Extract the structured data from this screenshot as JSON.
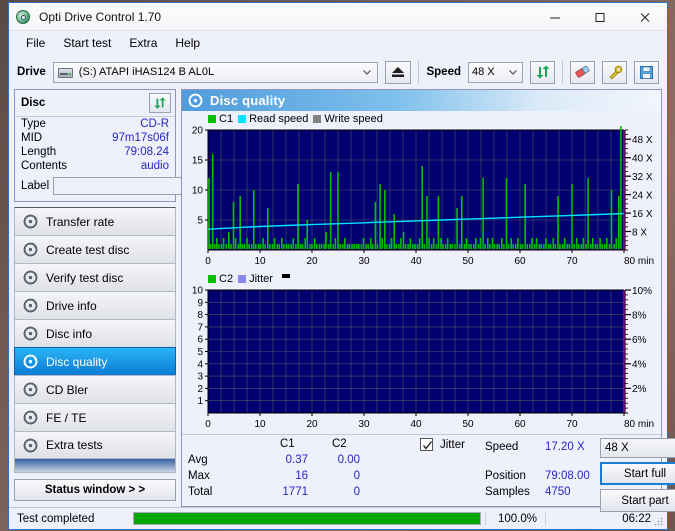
{
  "window": {
    "title": "Opti Drive Control 1.70",
    "app_icon": "disc-icon",
    "minimize": "—",
    "maximize": "□",
    "close": "✕"
  },
  "menu": {
    "items": [
      "File",
      "Start test",
      "Extra",
      "Help"
    ]
  },
  "toolbar": {
    "drive_label": "Drive",
    "drive_value": "(S:)  ATAPI iHAS124   B AL0L",
    "eject_icon": "eject-icon",
    "speed_label": "Speed",
    "speed_value": "48 X",
    "refresh_icon": "refresh-icon",
    "eraser_icon": "eraser-icon",
    "tools_icon": "tools-icon",
    "save_icon": "save-icon"
  },
  "disc_panel": {
    "title": "Disc",
    "refresh_icon": "refresh-icon",
    "rows": [
      {
        "key": "Type",
        "value": "CD-R"
      },
      {
        "key": "MID",
        "value": "97m17s06f"
      },
      {
        "key": "Length",
        "value": "79:08.24"
      },
      {
        "key": "Contents",
        "value": "audio"
      }
    ],
    "label_key": "Label",
    "label_value": "",
    "label_placeholder": "",
    "disc_icon": "cd-disc-icon"
  },
  "tabs": [
    {
      "label": "Transfer rate",
      "icon": "disc-icon",
      "active": false
    },
    {
      "label": "Create test disc",
      "icon": "disc-icon",
      "active": false
    },
    {
      "label": "Verify test disc",
      "icon": "disc-icon",
      "active": false
    },
    {
      "label": "Drive info",
      "icon": "disc-icon",
      "active": false
    },
    {
      "label": "Disc info",
      "icon": "disc-icon",
      "active": false
    },
    {
      "label": "Disc quality",
      "icon": "disc-icon",
      "active": true
    },
    {
      "label": "CD Bler",
      "icon": "disc-icon",
      "active": false
    },
    {
      "label": "FE / TE",
      "icon": "disc-icon",
      "active": false
    },
    {
      "label": "Extra tests",
      "icon": "disc-icon",
      "active": false
    }
  ],
  "status_window_button": "Status window > >",
  "panel": {
    "header_title": "Disc quality",
    "header_icon": "disc-quality-icon"
  },
  "stats": {
    "col_c1": "C1",
    "col_c2": "C2",
    "rows": [
      {
        "label": "Avg",
        "c1": "0.37",
        "c2": "0.00"
      },
      {
        "label": "Max",
        "c1": "16",
        "c2": "0"
      },
      {
        "label": "Total",
        "c1": "1771",
        "c2": "0"
      }
    ],
    "jitter_label": "Jitter",
    "jitter_checked": true,
    "speed_label": "Speed",
    "speed_value": "17.20 X",
    "position_label": "Position",
    "position_value": "79:08.00",
    "samples_label": "Samples",
    "samples_value": "4750",
    "speed_select": "48 X",
    "start_full": "Start full",
    "start_part": "Start part"
  },
  "statusbar": {
    "text": "Test completed",
    "progress_percent": 100.0,
    "percent_label": "100.0%",
    "elapsed": "06:22"
  },
  "colors": {
    "c1": "#00c000",
    "c2": "#00c000",
    "read_speed": "#00e5ff",
    "write_speed": "#808080",
    "jitter": "#8888ee",
    "plot_bg": "#000070",
    "grid": "#707060",
    "accent": "#2626c8",
    "progress": "#00a800",
    "title_blue": "#2a6fc9",
    "marker_magenta": "#e000e0"
  },
  "chart_data": [
    {
      "id": "c1-chart",
      "type": "bar",
      "title": "C1 / Read speed",
      "xlabel": "min",
      "ylabel": "",
      "xlim": [
        0,
        80
      ],
      "xticks": [
        0,
        10,
        20,
        30,
        40,
        50,
        60,
        70,
        80
      ],
      "xtick_labels": [
        "0",
        "10",
        "20",
        "30",
        "40",
        "50",
        "60",
        "70",
        "80 min"
      ],
      "ylim": [
        0,
        20
      ],
      "yticks": [
        5,
        10,
        15,
        20
      ],
      "ytick_labels": [
        "5",
        "10",
        "15",
        "20"
      ],
      "y2lim": [
        0,
        52
      ],
      "y2ticks": [
        8,
        16,
        24,
        32,
        40,
        48
      ],
      "y2tick_labels": [
        "8 X",
        "16 X",
        "24 X",
        "32 X",
        "40 X",
        "48 X"
      ],
      "grid": true,
      "legend": [
        {
          "name": "C1",
          "color": "#00c000"
        },
        {
          "name": "Read speed",
          "color": "#00e5ff"
        },
        {
          "name": "Write speed",
          "color": "#808080"
        }
      ],
      "series": [
        {
          "name": "C1",
          "kind": "impulse",
          "color": "#00c000",
          "x": [
            0.2,
            0.5,
            0.9,
            1.3,
            1.7,
            2.1,
            2.6,
            3.0,
            3.5,
            4.0,
            4.4,
            4.9,
            5.3,
            5.8,
            6.2,
            6.6,
            7.0,
            7.5,
            7.9,
            8.4,
            8.8,
            9.2,
            9.7,
            10.1,
            10.6,
            11.0,
            11.5,
            11.9,
            12.4,
            12.8,
            13.3,
            13.7,
            14.2,
            14.6,
            15.1,
            15.5,
            16.0,
            16.4,
            16.9,
            17.3,
            17.8,
            18.2,
            18.7,
            19.1,
            19.6,
            20.0,
            20.5,
            20.9,
            21.4,
            21.8,
            22.3,
            22.7,
            23.2,
            23.6,
            24.1,
            24.5,
            25.0,
            25.4,
            25.9,
            26.3,
            26.8,
            27.2,
            27.7,
            28.1,
            28.6,
            29.0,
            29.5,
            29.9,
            30.4,
            30.8,
            31.3,
            31.7,
            32.2,
            32.6,
            33.1,
            33.5,
            34.0,
            34.4,
            34.9,
            35.3,
            35.8,
            36.2,
            36.7,
            37.1,
            37.6,
            38.0,
            38.5,
            38.9,
            39.4,
            39.8,
            40.3,
            40.7,
            41.2,
            41.6,
            42.1,
            42.5,
            43.0,
            43.4,
            43.9,
            44.3,
            44.8,
            45.2,
            45.7,
            46.1,
            46.6,
            47.0,
            47.5,
            47.9,
            48.4,
            48.8,
            49.3,
            49.7,
            50.2,
            50.6,
            51.1,
            51.5,
            52.0,
            52.4,
            52.9,
            53.3,
            53.8,
            54.2,
            54.7,
            55.1,
            55.6,
            56.0,
            56.5,
            56.9,
            57.4,
            57.8,
            58.3,
            58.7,
            59.2,
            59.6,
            60.1,
            60.5,
            61.0,
            61.4,
            61.9,
            62.3,
            62.8,
            63.2,
            63.7,
            64.1,
            64.6,
            65.0,
            65.5,
            65.9,
            66.4,
            66.8,
            67.3,
            67.7,
            68.2,
            68.6,
            69.1,
            69.5,
            70.0,
            70.4,
            70.9,
            71.3,
            71.8,
            72.2,
            72.7,
            73.1,
            73.6,
            74.0,
            74.5,
            74.9,
            75.4,
            75.8,
            76.3,
            76.7,
            77.2,
            77.6,
            78.1,
            78.5,
            79.0,
            79.4
          ],
          "y": [
            12,
            1,
            16,
            1,
            2,
            1,
            1,
            2,
            1,
            3,
            1,
            8,
            2,
            1,
            9,
            1,
            1,
            2,
            1,
            1,
            10,
            1,
            1,
            1,
            2,
            1,
            7,
            1,
            1,
            2,
            1,
            1,
            2,
            1,
            1,
            1,
            1,
            2,
            1,
            11,
            1,
            1,
            2,
            5,
            1,
            1,
            2,
            1,
            1,
            1,
            1,
            3,
            1,
            13,
            1,
            2,
            13,
            1,
            1,
            2,
            1,
            1,
            1,
            1,
            1,
            1,
            1,
            2,
            1,
            1,
            2,
            1,
            8,
            1,
            11,
            2,
            10,
            1,
            1,
            2,
            6,
            1,
            1,
            2,
            3,
            1,
            1,
            2,
            1,
            1,
            1,
            2,
            14,
            1,
            9,
            2,
            1,
            2,
            1,
            9,
            2,
            1,
            1,
            2,
            1,
            1,
            1,
            7,
            1,
            9,
            1,
            2,
            1,
            1,
            1,
            2,
            1,
            2,
            12,
            1,
            2,
            1,
            2,
            1,
            1,
            1,
            2,
            1,
            12,
            1,
            2,
            1,
            1,
            2,
            1,
            1,
            11,
            1,
            1,
            2,
            1,
            2,
            1,
            1,
            1,
            2,
            1,
            1,
            2,
            1,
            9,
            1,
            1,
            2,
            1,
            1,
            11,
            1,
            2,
            1,
            1,
            2,
            1,
            12,
            1,
            2,
            1,
            1,
            2,
            1,
            1,
            2,
            1,
            10,
            1,
            2,
            9
          ]
        },
        {
          "name": "Read speed",
          "kind": "line",
          "color": "#00e5ff",
          "axis": "y2",
          "x": [
            0,
            5,
            10,
            15,
            20,
            25,
            30,
            35,
            40,
            45,
            50,
            55,
            60,
            65,
            70,
            75,
            80
          ],
          "y": [
            9.0,
            9.6,
            10.2,
            10.6,
            11.0,
            11.4,
            11.8,
            12.2,
            12.6,
            13.0,
            13.4,
            13.8,
            14.2,
            14.6,
            15.0,
            15.4,
            15.8
          ]
        }
      ]
    },
    {
      "id": "c2-chart",
      "type": "bar",
      "title": "C2 / Jitter",
      "xlabel": "min",
      "ylabel": "",
      "xlim": [
        0,
        80
      ],
      "xticks": [
        0,
        10,
        20,
        30,
        40,
        50,
        60,
        70,
        80
      ],
      "xtick_labels": [
        "0",
        "10",
        "20",
        "30",
        "40",
        "50",
        "60",
        "70",
        "80 min"
      ],
      "ylim": [
        0,
        10
      ],
      "yticks": [
        1,
        2,
        3,
        4,
        5,
        6,
        7,
        8,
        9,
        10
      ],
      "ytick_labels": [
        "1",
        "2",
        "3",
        "4",
        "5",
        "6",
        "7",
        "8",
        "9",
        "10"
      ],
      "y2lim": [
        0,
        10
      ],
      "y2ticks": [
        2,
        4,
        6,
        8,
        10
      ],
      "y2tick_labels": [
        "2%",
        "4%",
        "6%",
        "8%",
        "10%"
      ],
      "grid": true,
      "legend": [
        {
          "name": "C2",
          "color": "#00c000"
        },
        {
          "name": "Jitter",
          "color": "#8888ee"
        }
      ],
      "series": [
        {
          "name": "C2",
          "kind": "impulse",
          "color": "#00c000",
          "x": [],
          "y": []
        },
        {
          "name": "Jitter",
          "kind": "line",
          "color": "#8888ee",
          "axis": "y2",
          "x": [],
          "y": []
        }
      ]
    }
  ]
}
